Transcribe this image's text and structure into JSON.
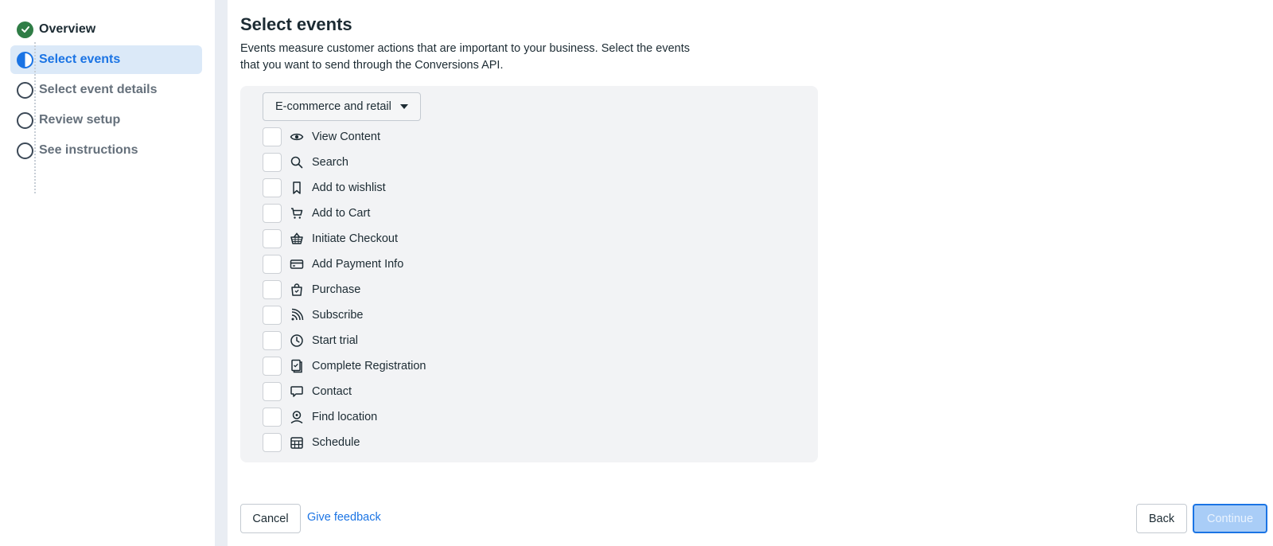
{
  "sidebar": {
    "steps": [
      {
        "label": "Overview",
        "state": "done"
      },
      {
        "label": "Select events",
        "state": "active"
      },
      {
        "label": "Select event details",
        "state": "todo"
      },
      {
        "label": "Review setup",
        "state": "todo"
      },
      {
        "label": "See instructions",
        "state": "todo"
      }
    ]
  },
  "main": {
    "title": "Select events",
    "description": "Events measure customer actions that are important to your business. Select the events that you want to send through the Conversions API.",
    "category": {
      "selected": "E-commerce and retail"
    },
    "events": [
      {
        "label": "View Content",
        "icon": "eye-icon",
        "checked": false
      },
      {
        "label": "Search",
        "icon": "search-icon",
        "checked": false
      },
      {
        "label": "Add to wishlist",
        "icon": "bookmark-icon",
        "checked": false
      },
      {
        "label": "Add to Cart",
        "icon": "cart-icon",
        "checked": false
      },
      {
        "label": "Initiate Checkout",
        "icon": "basket-icon",
        "checked": false
      },
      {
        "label": "Add Payment Info",
        "icon": "credit-card-icon",
        "checked": false
      },
      {
        "label": "Purchase",
        "icon": "shopping-bag-icon",
        "checked": false
      },
      {
        "label": "Subscribe",
        "icon": "rss-icon",
        "checked": false
      },
      {
        "label": "Start trial",
        "icon": "clock-icon",
        "checked": false
      },
      {
        "label": "Complete Registration",
        "icon": "registration-icon",
        "checked": false
      },
      {
        "label": "Contact",
        "icon": "chat-bubble-icon",
        "checked": false
      },
      {
        "label": "Find location",
        "icon": "location-pin-icon",
        "checked": false
      },
      {
        "label": "Schedule",
        "icon": "calendar-icon",
        "checked": false
      }
    ]
  },
  "footer": {
    "cancel_label": "Cancel",
    "feedback_label": "Give feedback",
    "back_label": "Back",
    "continue_label": "Continue"
  },
  "colors": {
    "accent": "#1b74e4",
    "done": "#2f7d46",
    "active_step_bg": "#dbe9f8"
  }
}
